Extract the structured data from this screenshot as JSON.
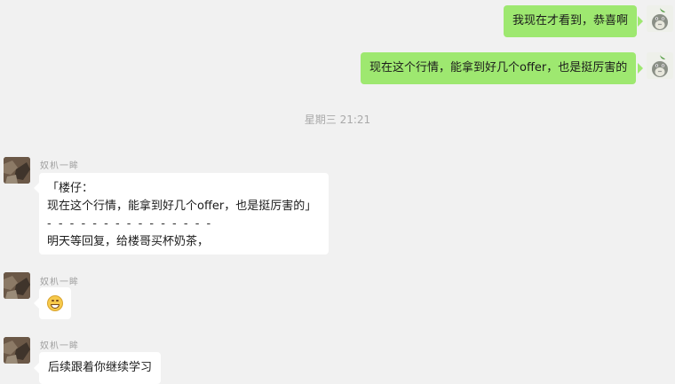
{
  "messages": {
    "m1": {
      "text": "我现在才看到，恭喜啊"
    },
    "m2": {
      "text": "现在这个行情，能拿到好几个offer，也是挺厉害的"
    },
    "timestamp": "星期三 21:21",
    "m3": {
      "sender": "奴朳一眸",
      "quote_open": "「楼仔：",
      "quote_body": "现在这个行情，能拿到好几个offer，也是挺厉害的」",
      "divider": "- - - - - - - - - - - - - - -",
      "text": "明天等回复，给楼哥买杯奶茶，"
    },
    "m4": {
      "sender": "奴朳一眸",
      "emoji": "grinning-face-emoji"
    },
    "m5": {
      "sender": "奴朳一眸",
      "text": "后续跟着你继续学习"
    }
  },
  "colors": {
    "background": "#f1f1f1",
    "self_bubble": "#9ee870",
    "other_bubble": "#ffffff",
    "timestamp": "#a9a9a9"
  }
}
